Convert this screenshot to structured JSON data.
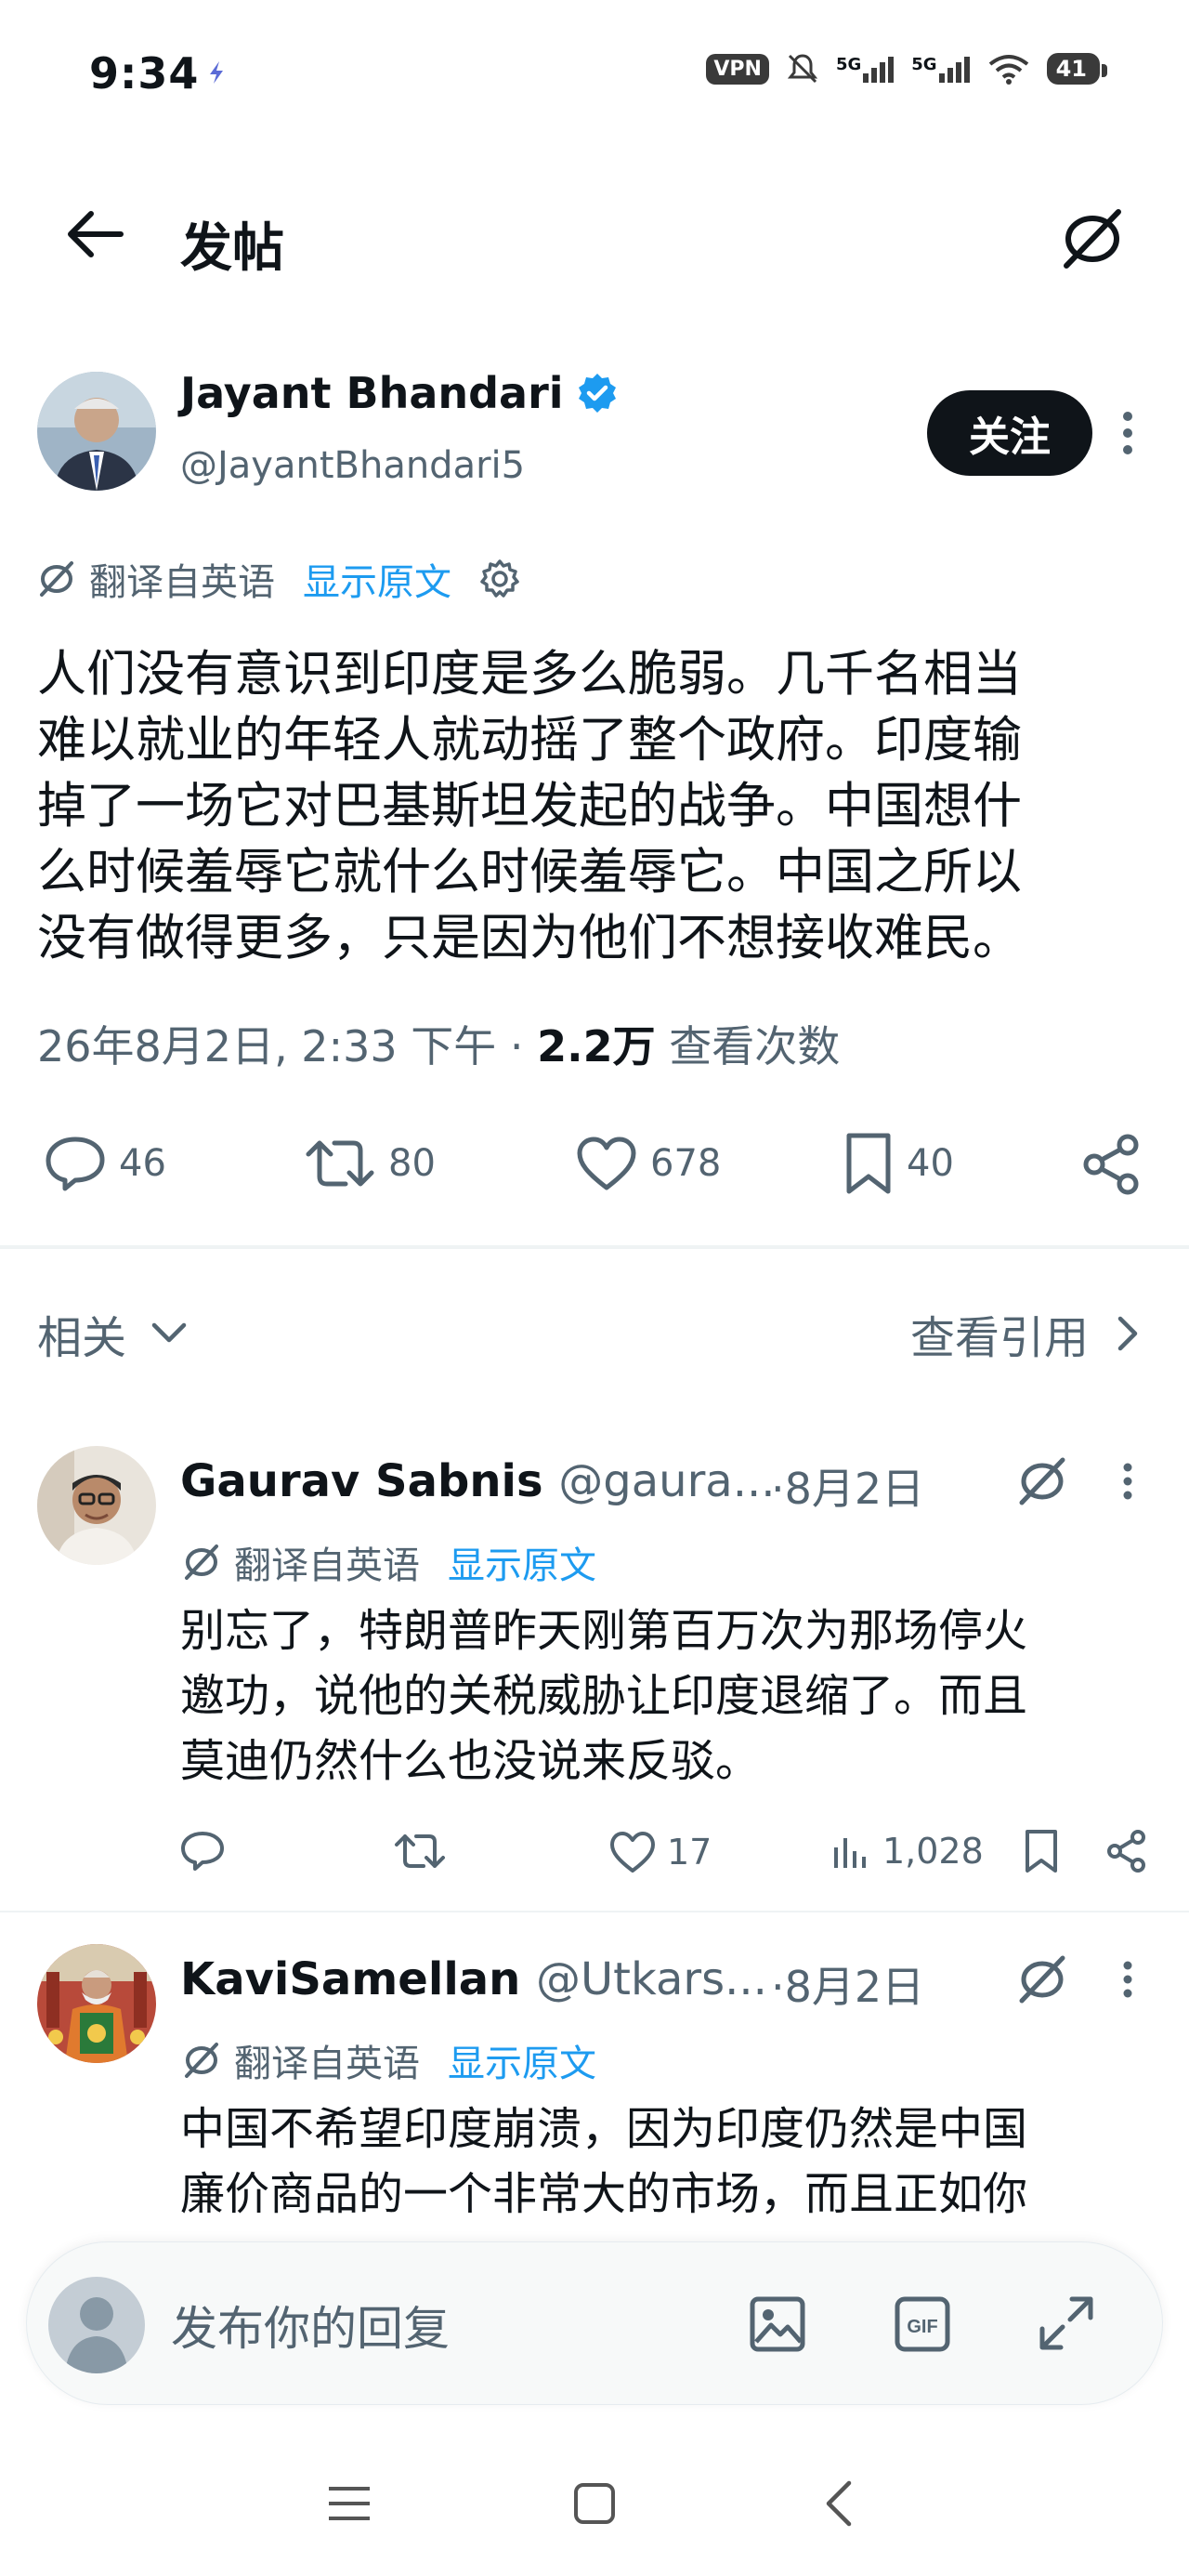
{
  "status_bar": {
    "time": "9:34",
    "vpn": "VPN",
    "signal_1": "5G",
    "signal_2": "5G",
    "battery": "41"
  },
  "header": {
    "title": "发帖",
    "back_icon": "arrow-left-icon",
    "translate_icon": "translate-slash-icon"
  },
  "post": {
    "author_name": "Jayant Bhandari",
    "author_handle": "@JayantBhandari5",
    "follow_label": "关注",
    "translate_label": "翻译自英语",
    "show_original_label": "显示原文",
    "lines": [
      "人们没有意识到印度是多么脆弱。几千名相当",
      "难以就业的年轻人就动摇了整个政府。印度输",
      "掉了一场它对巴基斯坦发起的战争。中国想什",
      "么时候羞辱它就什么时候羞辱它。中国之所以",
      "没有做得更多，只是因为他们不想接收难民。"
    ],
    "timestamp": "26年8月2日, 2:33 下午",
    "separator": "·",
    "views_count": "2.2万",
    "views_label": "查看次数",
    "replies": "46",
    "reposts": "80",
    "likes": "678",
    "bookmarks": "40"
  },
  "tabs": {
    "related_label": "相关",
    "quotes_label": "查看引用"
  },
  "replies": [
    {
      "name": "Gaurav Sabnis",
      "handle": "@gaura...",
      "date": "·8月2日",
      "translate_label": "翻译自英语",
      "show_original_label": "显示原文",
      "lines": [
        "别忘了，特朗普昨天刚第百万次为那场停火",
        "邀功，说他的关税威胁让印度退缩了。而且",
        "莫迪仍然什么也没说来反驳。"
      ],
      "likes": "17",
      "views": "1,028"
    },
    {
      "name": "KaviSamellan",
      "handle": "@Utkars...",
      "date": "·8月2日",
      "translate_label": "翻译自英语",
      "show_original_label": "显示原文",
      "lines": [
        "中国不希望印度崩溃，因为印度仍然是中国",
        "廉价商品的一个非常大的市场，而且正如你"
      ]
    }
  ],
  "composer": {
    "placeholder": "发布你的回复"
  },
  "colors": {
    "accent": "#1d9bf0",
    "text": "#0f1419",
    "muted": "#536471",
    "verified": "#1d9bf0"
  }
}
